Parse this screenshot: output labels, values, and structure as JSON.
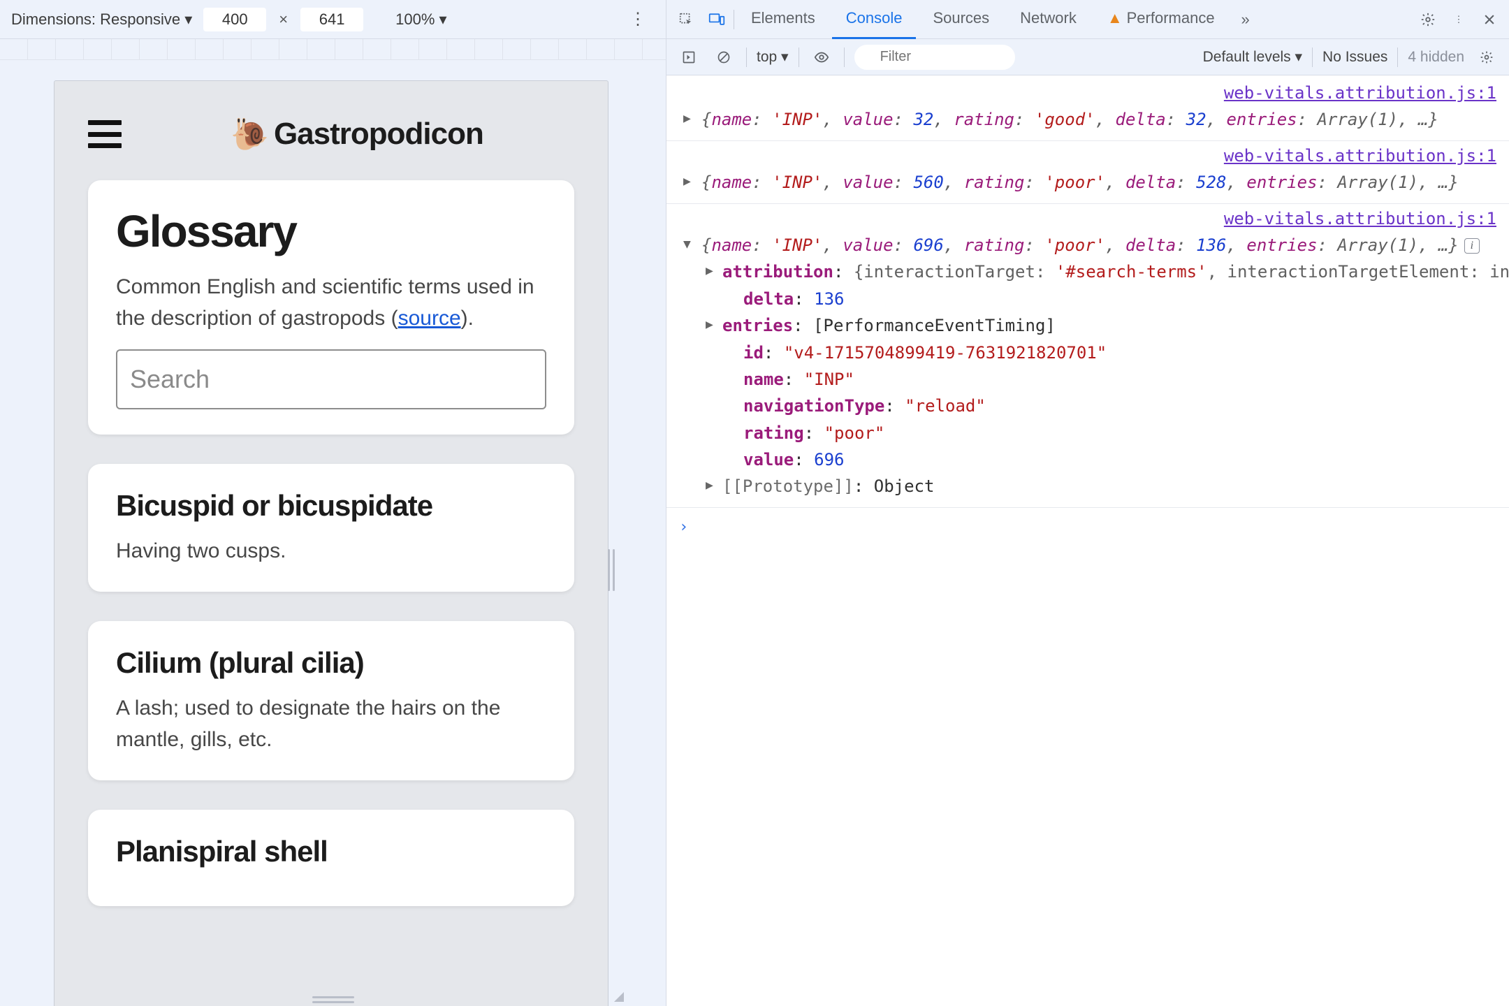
{
  "deviceToolbar": {
    "dimensionsLabel": "Dimensions: Responsive ▾",
    "width": "400",
    "height": "641",
    "zoom": "100% ▾"
  },
  "devtoolsTabs": {
    "elements": "Elements",
    "console": "Console",
    "sources": "Sources",
    "network": "Network",
    "performance": "Performance"
  },
  "consoleToolbar": {
    "context": "top ▾",
    "filterPlaceholder": "Filter",
    "levels": "Default levels ▾",
    "issues": "No Issues",
    "hidden": "4 hidden"
  },
  "app": {
    "title": "Gastropodicon",
    "glossary": {
      "heading": "Glossary",
      "descPrefix": "Common English and scientific terms used in the description of gastropods (",
      "sourceLabel": "source",
      "descSuffix": ").",
      "searchPlaceholder": "Search"
    },
    "entries": [
      {
        "term": "Bicuspid or bicuspidate",
        "def": "Having two cusps."
      },
      {
        "term": "Cilium (plural cilia)",
        "def": "A lash; used to designate the hairs on the mantle, gills, etc."
      },
      {
        "term": "Planispiral shell",
        "def": ""
      }
    ]
  },
  "console": {
    "srcLink": "web-vitals.attribution.js:1",
    "logs": [
      {
        "expanded": false,
        "summary": {
          "name": "'INP'",
          "value": "32",
          "rating": "'good'",
          "delta": "32",
          "rest": "entries: Array(1), …}"
        }
      },
      {
        "expanded": false,
        "summary": {
          "name": "'INP'",
          "value": "560",
          "rating": "'poor'",
          "delta": "528",
          "rest": "entries: Array(1), …}"
        }
      },
      {
        "expanded": true,
        "summary": {
          "name": "'INP'",
          "value": "696",
          "rating": "'poor'",
          "delta": "136",
          "rest": "entries: Array(1), …}"
        },
        "props": {
          "attribution": "{interactionTarget: '#search-terms', interactionTargetElement: in",
          "delta": "136",
          "entries": "[PerformanceEventTiming]",
          "id": "\"v4-1715704899419-7631921820701\"",
          "name": "\"INP\"",
          "navigationType": "\"reload\"",
          "rating": "\"poor\"",
          "value": "696",
          "prototype": "Object"
        }
      }
    ]
  }
}
